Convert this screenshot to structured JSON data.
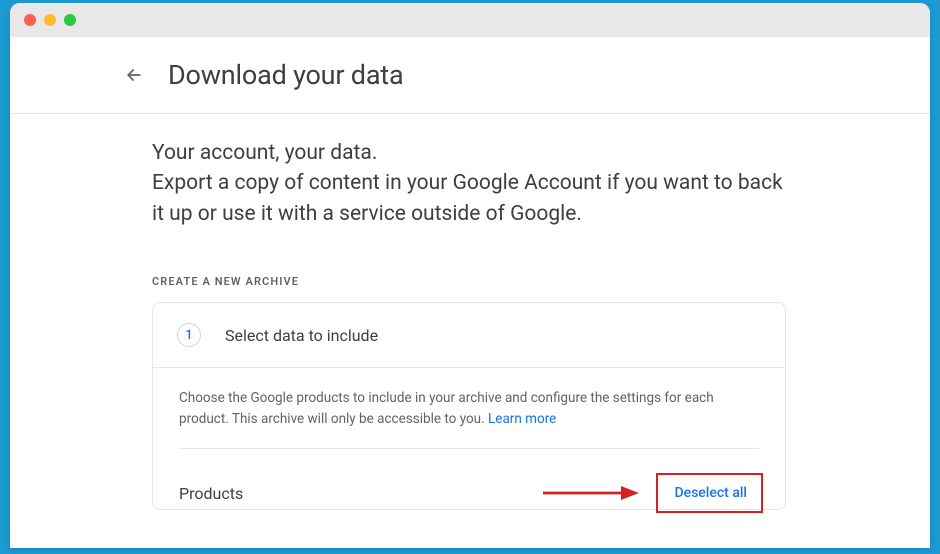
{
  "header": {
    "title": "Download your data"
  },
  "intro": {
    "heading": "Your account, your data.",
    "sub": "Export a copy of content in your Google Account if you want to back it up or use it with a service outside of Google."
  },
  "section_label": "CREATE A NEW ARCHIVE",
  "step1": {
    "number": "1",
    "title": "Select data to include",
    "helper": "Choose the Google products to include in your archive and configure the settings for each product. This archive will only be accessible to you. ",
    "learn_more": "Learn more"
  },
  "products": {
    "label": "Products",
    "deselect_all": "Deselect all"
  }
}
